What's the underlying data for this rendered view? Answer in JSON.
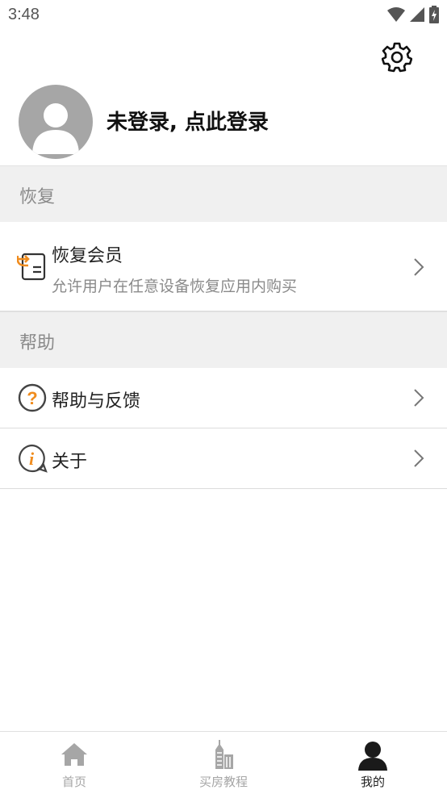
{
  "status_bar": {
    "time": "3:48"
  },
  "profile": {
    "login_text": "未登录, 点此登录"
  },
  "sections": {
    "restore": {
      "header": "恢复",
      "item": {
        "title": "恢复会员",
        "subtitle": "允许用户在任意设备恢复应用内购买"
      }
    },
    "help": {
      "header": "帮助",
      "items": [
        {
          "title": "帮助与反馈"
        },
        {
          "title": "关于"
        }
      ]
    }
  },
  "tabbar": {
    "tabs": [
      {
        "label": "首页",
        "icon": "home-icon",
        "active": false
      },
      {
        "label": "买房教程",
        "icon": "building-icon",
        "active": false
      },
      {
        "label": "我的",
        "icon": "person-icon",
        "active": true
      }
    ]
  },
  "colors": {
    "accent": "#f08c1e",
    "icon_gray": "#555555",
    "inactive_tab": "#a6a6a6"
  }
}
